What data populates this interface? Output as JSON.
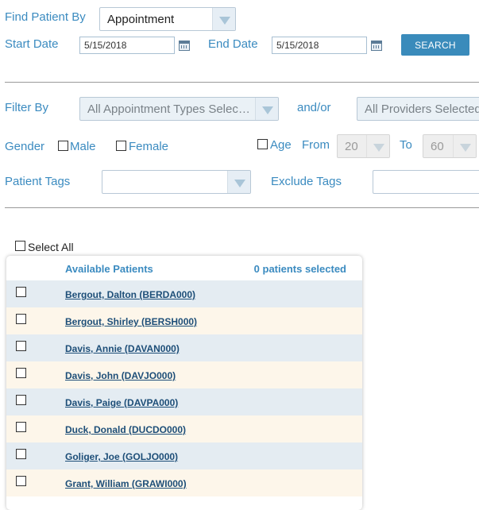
{
  "find": {
    "label": "Find Patient By",
    "value": "Appointment",
    "start_label": "Start Date",
    "start_value": "5/15/2018",
    "end_label": "End Date",
    "end_value": "5/15/2018",
    "search_label": "SEARCH"
  },
  "filter": {
    "label": "Filter By",
    "appointment_types": "All Appointment Types Selec…",
    "andor": "and/or",
    "providers": "All Providers Selected"
  },
  "gender": {
    "label": "Gender",
    "male": "Male",
    "female": "Female"
  },
  "age": {
    "label": "Age",
    "from_label": "From",
    "from_value": "20",
    "to_label": "To",
    "to_value": "60"
  },
  "tags": {
    "patient_label": "Patient Tags",
    "exclude_label": "Exclude Tags"
  },
  "select_all": "Select All",
  "patients": {
    "header": "Available Patients",
    "selected_count": "0 patients selected",
    "rows": [
      "Bergout, Dalton (BERDA000)",
      "Bergout, Shirley (BERSH000)",
      "Davis, Annie (DAVAN000)",
      "Davis, John (DAVJO000)",
      "Davis, Paige (DAVPA000)",
      "Duck, Donald (DUCDO000)",
      "Goliger, Joe (GOLJO000)",
      "Grant, William (GRAWI000)"
    ]
  },
  "colors": {
    "accent": "#3b8bc0",
    "button": "#3a8bbb",
    "row_blue": "#e4ecf2",
    "row_cream": "#fdf6ea",
    "link": "#1d4e78"
  }
}
